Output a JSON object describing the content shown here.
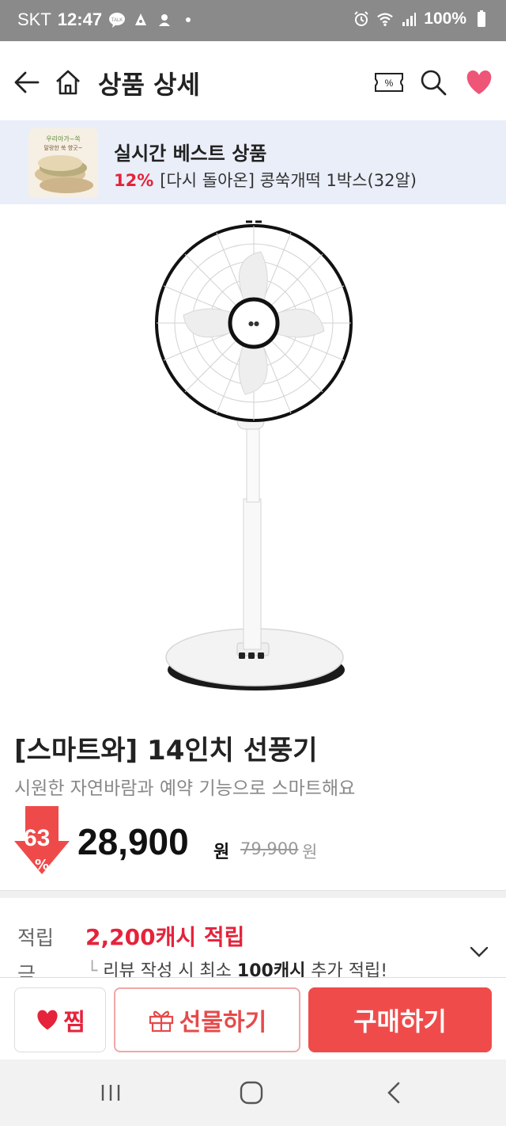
{
  "status_bar": {
    "carrier": "SKT",
    "time": "12:47",
    "battery": "100%"
  },
  "header": {
    "title": "상품 상세"
  },
  "banner": {
    "title": "실시간 베스트 상품",
    "discount": "12%",
    "product": "[다시 돌아온] 콩쑥개떡 1박스(32알)"
  },
  "product": {
    "title": "[스마트와] 14인치 선풍기",
    "subtitle": "시원한 자연바람과 예약 기능으로 스마트해요",
    "discount": "63",
    "discount_unit": "%",
    "price": "28,900",
    "price_unit": "원",
    "original_price": "79,900",
    "original_unit": "원"
  },
  "points": {
    "label": "적립금",
    "main": "2,200캐시 적립",
    "sub_prefix": "리뷰 작성 시 최소 ",
    "sub_bold": "100캐시",
    "sub_suffix": " 추가 적립!"
  },
  "actions": {
    "wish": "찜",
    "gift": "선물하기",
    "buy": "구매하기"
  },
  "colors": {
    "accent": "#e5233b",
    "buy_button": "#f04b4b",
    "banner_bg": "#e9eef9"
  }
}
